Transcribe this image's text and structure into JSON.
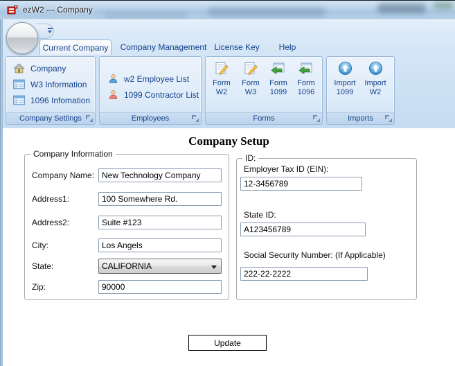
{
  "window": {
    "title": "ezW2 --- Company"
  },
  "tabs": [
    {
      "label": "Current Company",
      "active": true
    },
    {
      "label": "Company Management",
      "active": false
    },
    {
      "label": "License Key",
      "active": false
    },
    {
      "label": "Help",
      "active": false
    }
  ],
  "ribbon": {
    "groups": [
      {
        "label": "Company Settings",
        "items": [
          {
            "label": "Company",
            "icon": "house-icon"
          },
          {
            "label": "W3 Information",
            "icon": "form-grid-icon"
          },
          {
            "label": "1096 Infomation",
            "icon": "form-grid-icon"
          }
        ]
      },
      {
        "label": "Employees",
        "items": [
          {
            "label": "w2 Employee List",
            "icon": "person-blue-icon"
          },
          {
            "label": "1099 Contractor List",
            "icon": "person-red-icon"
          }
        ]
      },
      {
        "label": "Forms",
        "items": [
          {
            "line1": "Form",
            "line2": "W2",
            "icon": "edit-form-icon"
          },
          {
            "line1": "Form",
            "line2": "W3",
            "icon": "edit-form-icon"
          },
          {
            "line1": "Form",
            "line2": "1099",
            "icon": "table-arrow-icon"
          },
          {
            "line1": "Form",
            "line2": "1096",
            "icon": "table-arrow-icon"
          }
        ]
      },
      {
        "label": "Imports",
        "items": [
          {
            "line1": "Import",
            "line2": "1099",
            "icon": "import-icon"
          },
          {
            "line1": "Import",
            "line2": "W2",
            "icon": "import-icon"
          }
        ]
      }
    ]
  },
  "main": {
    "title": "Company Setup",
    "company_info": {
      "legend": "Company Information",
      "fields": [
        {
          "label": "Company Name:",
          "value": "New Technology Company"
        },
        {
          "label": "Address1:",
          "value": "100 Somewhere Rd."
        },
        {
          "label": "Address2:",
          "value": "Suite #123"
        },
        {
          "label": "City:",
          "value": "Los Angels"
        },
        {
          "label": "State:",
          "value": "CALIFORNIA"
        },
        {
          "label": "Zip:",
          "value": "90000"
        }
      ]
    },
    "id_section": {
      "legend": "ID:",
      "fields": [
        {
          "label": "Employer Tax ID (EIN):",
          "value": "12-3456789"
        },
        {
          "label": "State ID:",
          "value": "A123456789"
        },
        {
          "label": "Social Security Number: (If Applicable)",
          "value": "222-22-2222"
        }
      ]
    },
    "update_button": "Update"
  },
  "colors": {
    "ribbon_text": "#15428b",
    "titlebar_glass": "#bcd3e9",
    "ribbon_bg": "#d3e5f6",
    "app_icon_red": "#d42a1e",
    "content_bg": "#ffffff"
  }
}
